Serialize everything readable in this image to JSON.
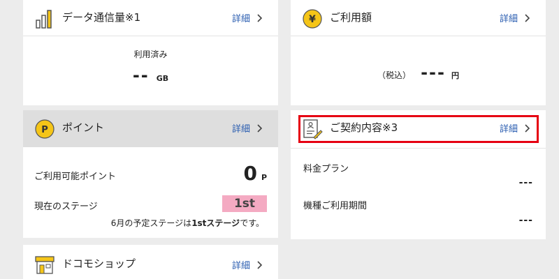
{
  "data_card": {
    "title": "データ通信量※1",
    "detail": "詳細",
    "used_label": "利用済み",
    "used_value": "--",
    "used_unit": "GB"
  },
  "amount_card": {
    "title": "ご利用額",
    "detail": "詳細",
    "tax_label": "（税込）",
    "amount_value": "---",
    "amount_unit": "円",
    "icon_glyph": "¥"
  },
  "point_card": {
    "title": "ポイント",
    "detail": "詳細",
    "icon_glyph": "P",
    "available_label": "ご利用可能ポイント",
    "available_value": "0",
    "available_unit": "P",
    "stage_label": "現在のステージ",
    "stage_value": "1st",
    "next_stage_prefix": "6月の予定ステージは",
    "next_stage_value": "1stステージ",
    "next_stage_suffix": "です。"
  },
  "contract_card": {
    "title": "ご契約内容※3",
    "detail": "詳細",
    "plan_label": "料金プラン",
    "plan_value": "---",
    "period_label": "機種ご利用期間",
    "period_value": "---"
  },
  "shop_card": {
    "title": "ドコモショップ",
    "detail": "詳細"
  },
  "colors": {
    "accent_blue": "#2a5db0",
    "icon_yellow": "#f5c518",
    "highlight_red": "#e60012",
    "stage_pink": "#f4aac2"
  }
}
